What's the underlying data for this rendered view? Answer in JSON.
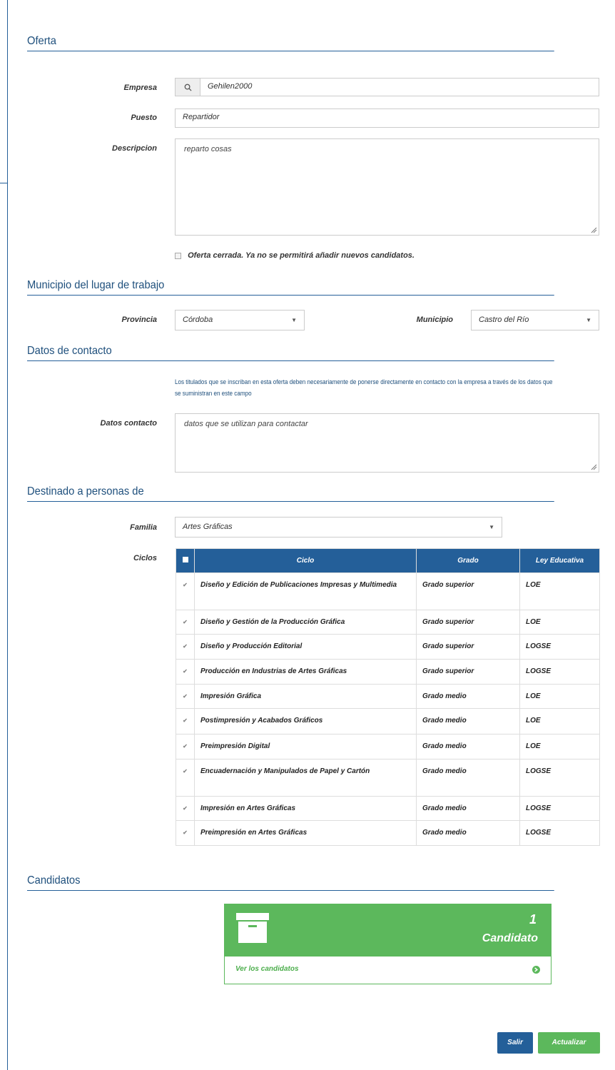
{
  "sections": {
    "oferta": "Oferta",
    "municipio": "Municipio del lugar de trabajo",
    "contacto": "Datos de contacto",
    "destinado": "Destinado a personas de",
    "candidatos": "Candidatos"
  },
  "oferta": {
    "empresa_label": "Empresa",
    "empresa_value": "Gehilen2000",
    "puesto_label": "Puesto",
    "puesto_value": "Repartidor",
    "descripcion_label": "Descripcion",
    "descripcion_value": "reparto cosas",
    "cerrada_label": "Oferta cerrada. Ya no se permitirá añadir nuevos candidatos."
  },
  "municipio": {
    "provincia_label": "Provincia",
    "provincia_value": "Córdoba",
    "municipio_label": "Municipio",
    "municipio_value": "Castro del Río"
  },
  "contacto": {
    "note": "Los titulados que se inscriban en esta oferta deben necesariamente de ponerse directamente en contacto con la empresa a través de los datos que se suministran en este campo",
    "datos_label": "Datos contacto",
    "datos_value": "datos que se utilizan para contactar"
  },
  "destinado": {
    "familia_label": "Familia",
    "familia_value": "Artes Gráficas",
    "ciclos_label": "Ciclos",
    "headers": [
      "Ciclo",
      "Grado",
      "Ley Educativa"
    ],
    "rows": [
      {
        "ciclo": "Diseño y Edición de Publicaciones Impresas y Multimedia",
        "grado": "Grado superior",
        "ley": "LOE"
      },
      {
        "ciclo": "Diseño y Gestión de la Producción Gráfica",
        "grado": "Grado superior",
        "ley": "LOE"
      },
      {
        "ciclo": "Diseño y Producción Editorial",
        "grado": "Grado superior",
        "ley": "LOGSE"
      },
      {
        "ciclo": "Producción en Industrias de Artes Gráficas",
        "grado": "Grado superior",
        "ley": "LOGSE"
      },
      {
        "ciclo": "Impresión Gráfica",
        "grado": "Grado medio",
        "ley": "LOE"
      },
      {
        "ciclo": "Postimpresión y Acabados Gráficos",
        "grado": "Grado medio",
        "ley": "LOE"
      },
      {
        "ciclo": "Preimpresión Digital",
        "grado": "Grado medio",
        "ley": "LOE"
      },
      {
        "ciclo": "Encuadernación y Manipulados de Papel y Cartón",
        "grado": "Grado medio",
        "ley": "LOGSE"
      },
      {
        "ciclo": "Impresión en Artes Gráficas",
        "grado": "Grado medio",
        "ley": "LOGSE"
      },
      {
        "ciclo": "Preimpresión en Artes Gráficas",
        "grado": "Grado medio",
        "ley": "LOGSE"
      }
    ]
  },
  "candidatos": {
    "count": "1",
    "label": "Candidato",
    "link": "Ver los candidatos"
  },
  "buttons": {
    "salir": "Salir",
    "actualizar": "Actualizar"
  },
  "colors": {
    "primary": "#245f99",
    "success": "#5cb85c"
  }
}
